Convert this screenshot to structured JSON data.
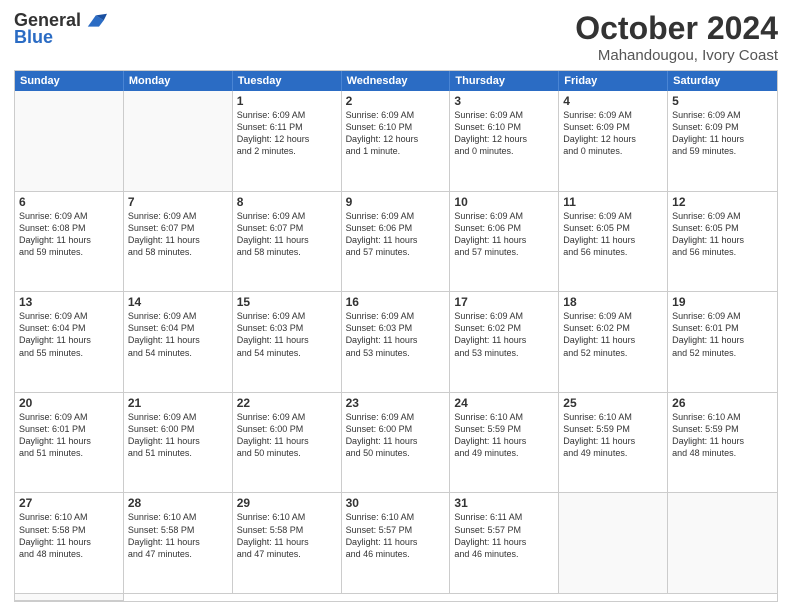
{
  "logo": {
    "general": "General",
    "blue": "Blue"
  },
  "title": "October 2024",
  "location": "Mahandougou, Ivory Coast",
  "days": [
    "Sunday",
    "Monday",
    "Tuesday",
    "Wednesday",
    "Thursday",
    "Friday",
    "Saturday"
  ],
  "cells": [
    {
      "day": "",
      "empty": true
    },
    {
      "day": "",
      "empty": true
    },
    {
      "day": "1",
      "info": "Sunrise: 6:09 AM\nSunset: 6:11 PM\nDaylight: 12 hours\nand 2 minutes."
    },
    {
      "day": "2",
      "info": "Sunrise: 6:09 AM\nSunset: 6:10 PM\nDaylight: 12 hours\nand 1 minute."
    },
    {
      "day": "3",
      "info": "Sunrise: 6:09 AM\nSunset: 6:10 PM\nDaylight: 12 hours\nand 0 minutes."
    },
    {
      "day": "4",
      "info": "Sunrise: 6:09 AM\nSunset: 6:09 PM\nDaylight: 12 hours\nand 0 minutes."
    },
    {
      "day": "5",
      "info": "Sunrise: 6:09 AM\nSunset: 6:09 PM\nDaylight: 11 hours\nand 59 minutes."
    },
    {
      "day": "6",
      "info": "Sunrise: 6:09 AM\nSunset: 6:08 PM\nDaylight: 11 hours\nand 59 minutes."
    },
    {
      "day": "7",
      "info": "Sunrise: 6:09 AM\nSunset: 6:07 PM\nDaylight: 11 hours\nand 58 minutes."
    },
    {
      "day": "8",
      "info": "Sunrise: 6:09 AM\nSunset: 6:07 PM\nDaylight: 11 hours\nand 58 minutes."
    },
    {
      "day": "9",
      "info": "Sunrise: 6:09 AM\nSunset: 6:06 PM\nDaylight: 11 hours\nand 57 minutes."
    },
    {
      "day": "10",
      "info": "Sunrise: 6:09 AM\nSunset: 6:06 PM\nDaylight: 11 hours\nand 57 minutes."
    },
    {
      "day": "11",
      "info": "Sunrise: 6:09 AM\nSunset: 6:05 PM\nDaylight: 11 hours\nand 56 minutes."
    },
    {
      "day": "12",
      "info": "Sunrise: 6:09 AM\nSunset: 6:05 PM\nDaylight: 11 hours\nand 56 minutes."
    },
    {
      "day": "13",
      "info": "Sunrise: 6:09 AM\nSunset: 6:04 PM\nDaylight: 11 hours\nand 55 minutes."
    },
    {
      "day": "14",
      "info": "Sunrise: 6:09 AM\nSunset: 6:04 PM\nDaylight: 11 hours\nand 54 minutes."
    },
    {
      "day": "15",
      "info": "Sunrise: 6:09 AM\nSunset: 6:03 PM\nDaylight: 11 hours\nand 54 minutes."
    },
    {
      "day": "16",
      "info": "Sunrise: 6:09 AM\nSunset: 6:03 PM\nDaylight: 11 hours\nand 53 minutes."
    },
    {
      "day": "17",
      "info": "Sunrise: 6:09 AM\nSunset: 6:02 PM\nDaylight: 11 hours\nand 53 minutes."
    },
    {
      "day": "18",
      "info": "Sunrise: 6:09 AM\nSunset: 6:02 PM\nDaylight: 11 hours\nand 52 minutes."
    },
    {
      "day": "19",
      "info": "Sunrise: 6:09 AM\nSunset: 6:01 PM\nDaylight: 11 hours\nand 52 minutes."
    },
    {
      "day": "20",
      "info": "Sunrise: 6:09 AM\nSunset: 6:01 PM\nDaylight: 11 hours\nand 51 minutes."
    },
    {
      "day": "21",
      "info": "Sunrise: 6:09 AM\nSunset: 6:00 PM\nDaylight: 11 hours\nand 51 minutes."
    },
    {
      "day": "22",
      "info": "Sunrise: 6:09 AM\nSunset: 6:00 PM\nDaylight: 11 hours\nand 50 minutes."
    },
    {
      "day": "23",
      "info": "Sunrise: 6:09 AM\nSunset: 6:00 PM\nDaylight: 11 hours\nand 50 minutes."
    },
    {
      "day": "24",
      "info": "Sunrise: 6:10 AM\nSunset: 5:59 PM\nDaylight: 11 hours\nand 49 minutes."
    },
    {
      "day": "25",
      "info": "Sunrise: 6:10 AM\nSunset: 5:59 PM\nDaylight: 11 hours\nand 49 minutes."
    },
    {
      "day": "26",
      "info": "Sunrise: 6:10 AM\nSunset: 5:59 PM\nDaylight: 11 hours\nand 48 minutes."
    },
    {
      "day": "27",
      "info": "Sunrise: 6:10 AM\nSunset: 5:58 PM\nDaylight: 11 hours\nand 48 minutes."
    },
    {
      "day": "28",
      "info": "Sunrise: 6:10 AM\nSunset: 5:58 PM\nDaylight: 11 hours\nand 47 minutes."
    },
    {
      "day": "29",
      "info": "Sunrise: 6:10 AM\nSunset: 5:58 PM\nDaylight: 11 hours\nand 47 minutes."
    },
    {
      "day": "30",
      "info": "Sunrise: 6:10 AM\nSunset: 5:57 PM\nDaylight: 11 hours\nand 46 minutes."
    },
    {
      "day": "31",
      "info": "Sunrise: 6:11 AM\nSunset: 5:57 PM\nDaylight: 11 hours\nand 46 minutes."
    },
    {
      "day": "",
      "empty": true
    },
    {
      "day": "",
      "empty": true
    },
    {
      "day": "",
      "empty": true
    }
  ]
}
